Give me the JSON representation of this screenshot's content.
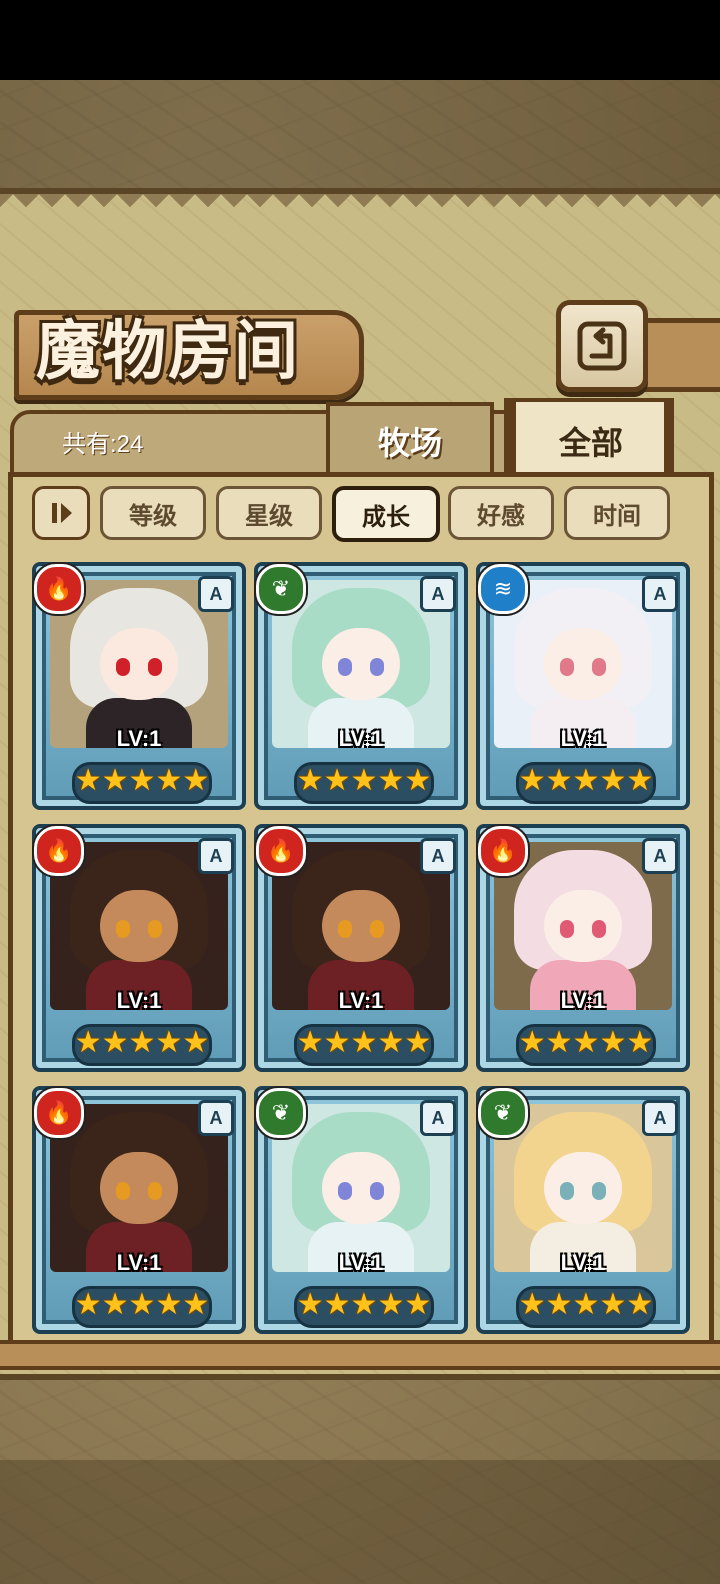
{
  "title": "魔物房间",
  "count_label": "共有:24",
  "tabs": [
    {
      "label": "牧场",
      "active": false
    },
    {
      "label": "全部",
      "active": true
    }
  ],
  "sort": {
    "toggle_icon": "sort-order-icon",
    "options": [
      {
        "label": "等级",
        "active": false
      },
      {
        "label": "星级",
        "active": false
      },
      {
        "label": "成长",
        "active": true
      },
      {
        "label": "好感",
        "active": false
      },
      {
        "label": "时间",
        "active": false
      }
    ]
  },
  "monsters": [
    {
      "element": "fire",
      "rank": "A",
      "level": "LV:1",
      "stars": 5
    },
    {
      "element": "wood",
      "rank": "A",
      "level": "LV:1",
      "stars": 5
    },
    {
      "element": "water",
      "rank": "A",
      "level": "LV:1",
      "stars": 5
    },
    {
      "element": "fire",
      "rank": "A",
      "level": "LV:1",
      "stars": 5
    },
    {
      "element": "fire",
      "rank": "A",
      "level": "LV:1",
      "stars": 5
    },
    {
      "element": "fire",
      "rank": "A",
      "level": "LV:1",
      "stars": 5
    },
    {
      "element": "fire",
      "rank": "A",
      "level": "LV:1",
      "stars": 5
    },
    {
      "element": "wood",
      "rank": "A",
      "level": "LV:1",
      "stars": 5
    },
    {
      "element": "wood",
      "rank": "A",
      "level": "LV:1",
      "stars": 5
    }
  ],
  "colors": {
    "fire": "#d0241f",
    "wood": "#2f7a2c",
    "water": "#1f7fc8",
    "accent_brown": "#5e3d1a",
    "panel": "#c9bb86"
  }
}
